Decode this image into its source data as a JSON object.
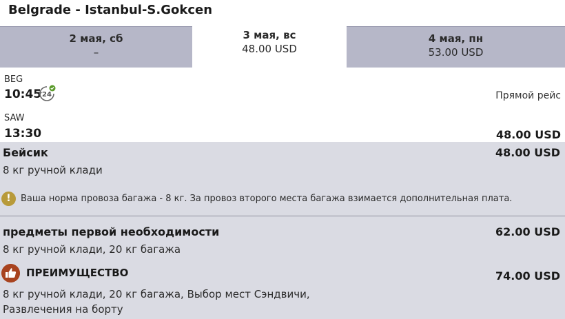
{
  "route": {
    "title": "Belgrade  -  Istanbul-S.Gokcen"
  },
  "date_tabs": [
    {
      "date": "2 мая, сб",
      "price": "–"
    },
    {
      "date": "3 мая, вс",
      "price": "48.00 USD"
    },
    {
      "date": "4 мая, пн",
      "price": "53.00 USD"
    }
  ],
  "flight": {
    "departure_code": "BEG",
    "departure_time": "10:45",
    "arrival_code": "SAW",
    "arrival_time": "13:30",
    "direct_label": "Прямой рейс",
    "price": "48.00 USD",
    "clock_icon_text": "24"
  },
  "fares": {
    "basic": {
      "name": "Бейсик",
      "price": "48.00 USD",
      "desc": "8 кг ручной клади",
      "notice": "Ваша норма провоза багажа - 8 кг. За провоз второго места багажа взимается дополнительная плата."
    },
    "essentials": {
      "name": "предметы первой необходимости",
      "price": "62.00 USD",
      "desc": "8 кг ручной клади, 20 кг багажа"
    },
    "advantage": {
      "name": "ПРЕИМУЩЕСТВО",
      "price": "74.00 USD",
      "desc": "8 кг ручной клади, 20 кг багажа, Выбор мест  Сэндвичи, Развлечения на борту"
    }
  },
  "colors": {
    "tab_inactive": "#b6b7c8",
    "fare_panel": "#dadbe3",
    "notice_icon": "#b89a3a",
    "advantage_icon": "#a8431f",
    "check_badge": "#5a9a2a"
  }
}
